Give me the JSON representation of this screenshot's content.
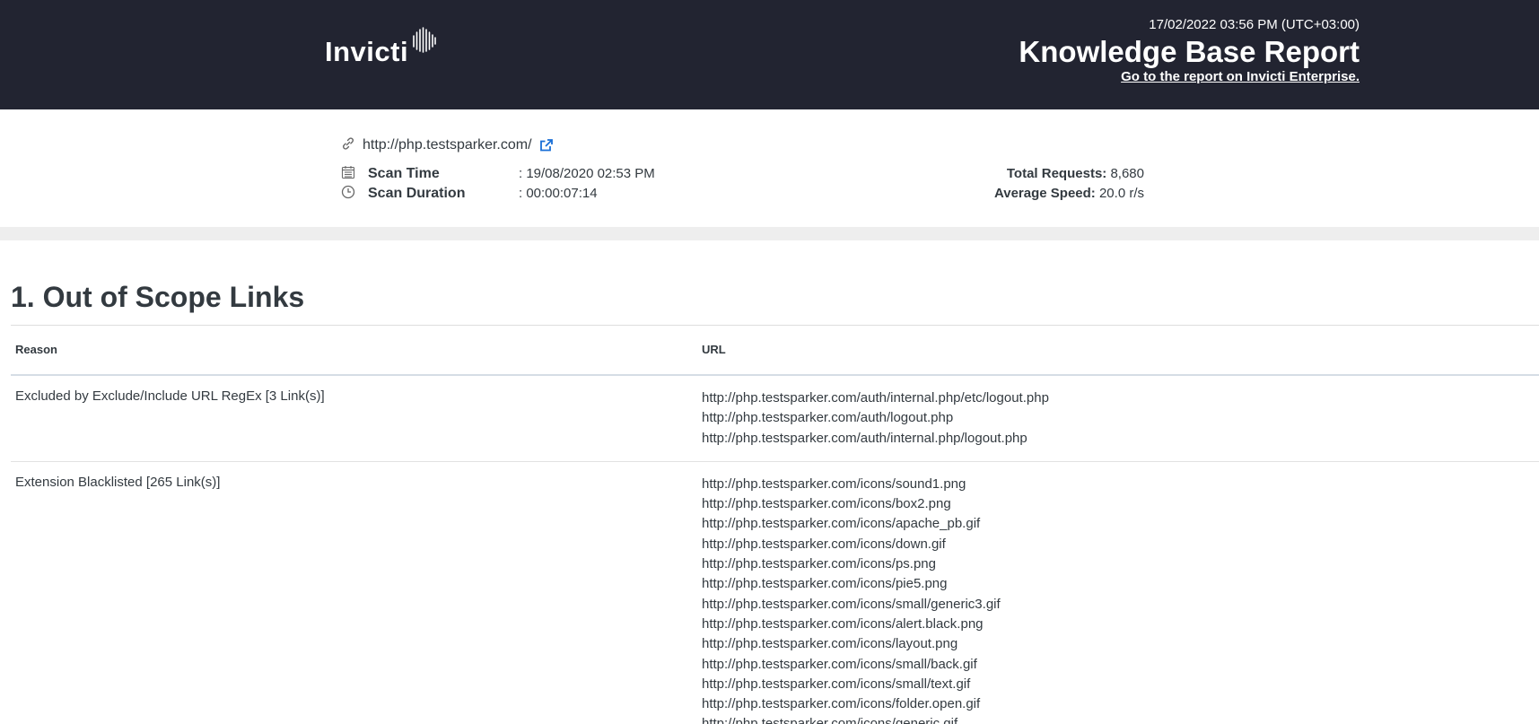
{
  "header": {
    "logo_text": "Invicti",
    "date": "17/02/2022 03:56 PM (UTC+03:00)",
    "title": "Knowledge Base Report",
    "enterprise_link": "Go to the report on Invicti Enterprise."
  },
  "scan": {
    "target_url": "http://php.testsparker.com/",
    "scan_time_label": "Scan Time",
    "scan_time_value": ": 19/08/2020 02:53 PM",
    "scan_duration_label": "Scan Duration",
    "scan_duration_value": ": 00:00:07:14",
    "total_requests_label": "Total Requests:",
    "total_requests_value": "8,680",
    "average_speed_label": "Average Speed:",
    "average_speed_value": "20.0 r/s"
  },
  "section": {
    "title": "1. Out of Scope Links",
    "columns": [
      "Reason",
      "URL"
    ],
    "rows": [
      {
        "reason": "Excluded by Exclude/Include URL RegEx [3 Link(s)]",
        "urls": [
          "http://php.testsparker.com/auth/internal.php/etc/logout.php",
          "http://php.testsparker.com/auth/logout.php",
          "http://php.testsparker.com/auth/internal.php/logout.php"
        ]
      },
      {
        "reason": "Extension Blacklisted [265 Link(s)]",
        "urls": [
          "http://php.testsparker.com/icons/sound1.png",
          "http://php.testsparker.com/icons/box2.png",
          "http://php.testsparker.com/icons/apache_pb.gif",
          "http://php.testsparker.com/icons/down.gif",
          "http://php.testsparker.com/icons/ps.png",
          "http://php.testsparker.com/icons/pie5.png",
          "http://php.testsparker.com/icons/small/generic3.gif",
          "http://php.testsparker.com/icons/alert.black.png",
          "http://php.testsparker.com/icons/layout.png",
          "http://php.testsparker.com/icons/small/back.gif",
          "http://php.testsparker.com/icons/small/text.gif",
          "http://php.testsparker.com/icons/folder.open.gif",
          "http://php.testsparker.com/icons/generic.gif"
        ]
      }
    ]
  },
  "icons": {
    "link": "link-icon",
    "external": "external-link-icon",
    "calendar": "calendar-icon",
    "clock": "clock-icon"
  },
  "colors": {
    "header_bg": "#222431",
    "text": "#333a40",
    "external_link": "#1a6fd6",
    "band": "#eeeeee"
  }
}
